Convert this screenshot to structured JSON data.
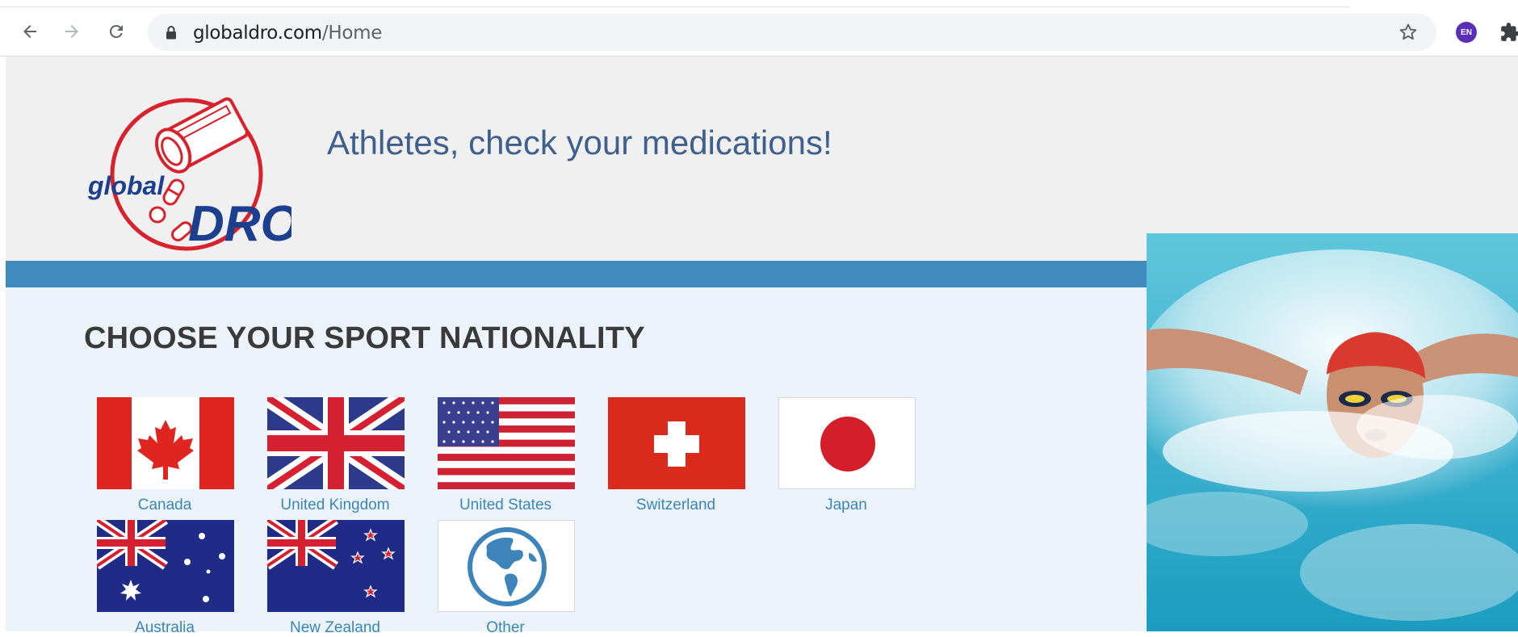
{
  "browser": {
    "url_domain": "globaldro.com",
    "url_path": "/Home",
    "profile_badge": "EN",
    "icons": [
      "back-arrow-icon",
      "forward-arrow-icon",
      "reload-icon",
      "lock-icon",
      "bookmark-star-icon",
      "extensions-puzzle-icon"
    ]
  },
  "header": {
    "logo_text_global": "global",
    "logo_text_dro": "DRO",
    "tagline": "Athletes, check your medications!"
  },
  "main": {
    "section_title": "CHOOSE YOUR SPORT NATIONALITY",
    "countries": [
      {
        "label": "Canada",
        "flag": "canada-flag"
      },
      {
        "label": "United Kingdom",
        "flag": "uk-flag"
      },
      {
        "label": "United States",
        "flag": "us-flag"
      },
      {
        "label": "Switzerland",
        "flag": "switzerland-flag"
      },
      {
        "label": "Japan",
        "flag": "japan-flag"
      },
      {
        "label": "Australia",
        "flag": "australia-flag"
      },
      {
        "label": "New Zealand",
        "flag": "new-zealand-flag"
      },
      {
        "label": "Other",
        "flag": "globe-icon"
      }
    ]
  },
  "colors": {
    "accent_blue": "#3f8bbd",
    "tagline": "#3f5f8c",
    "link": "#3a86b8",
    "logo_red": "#d9212b",
    "logo_blue": "#1d3f8f"
  }
}
